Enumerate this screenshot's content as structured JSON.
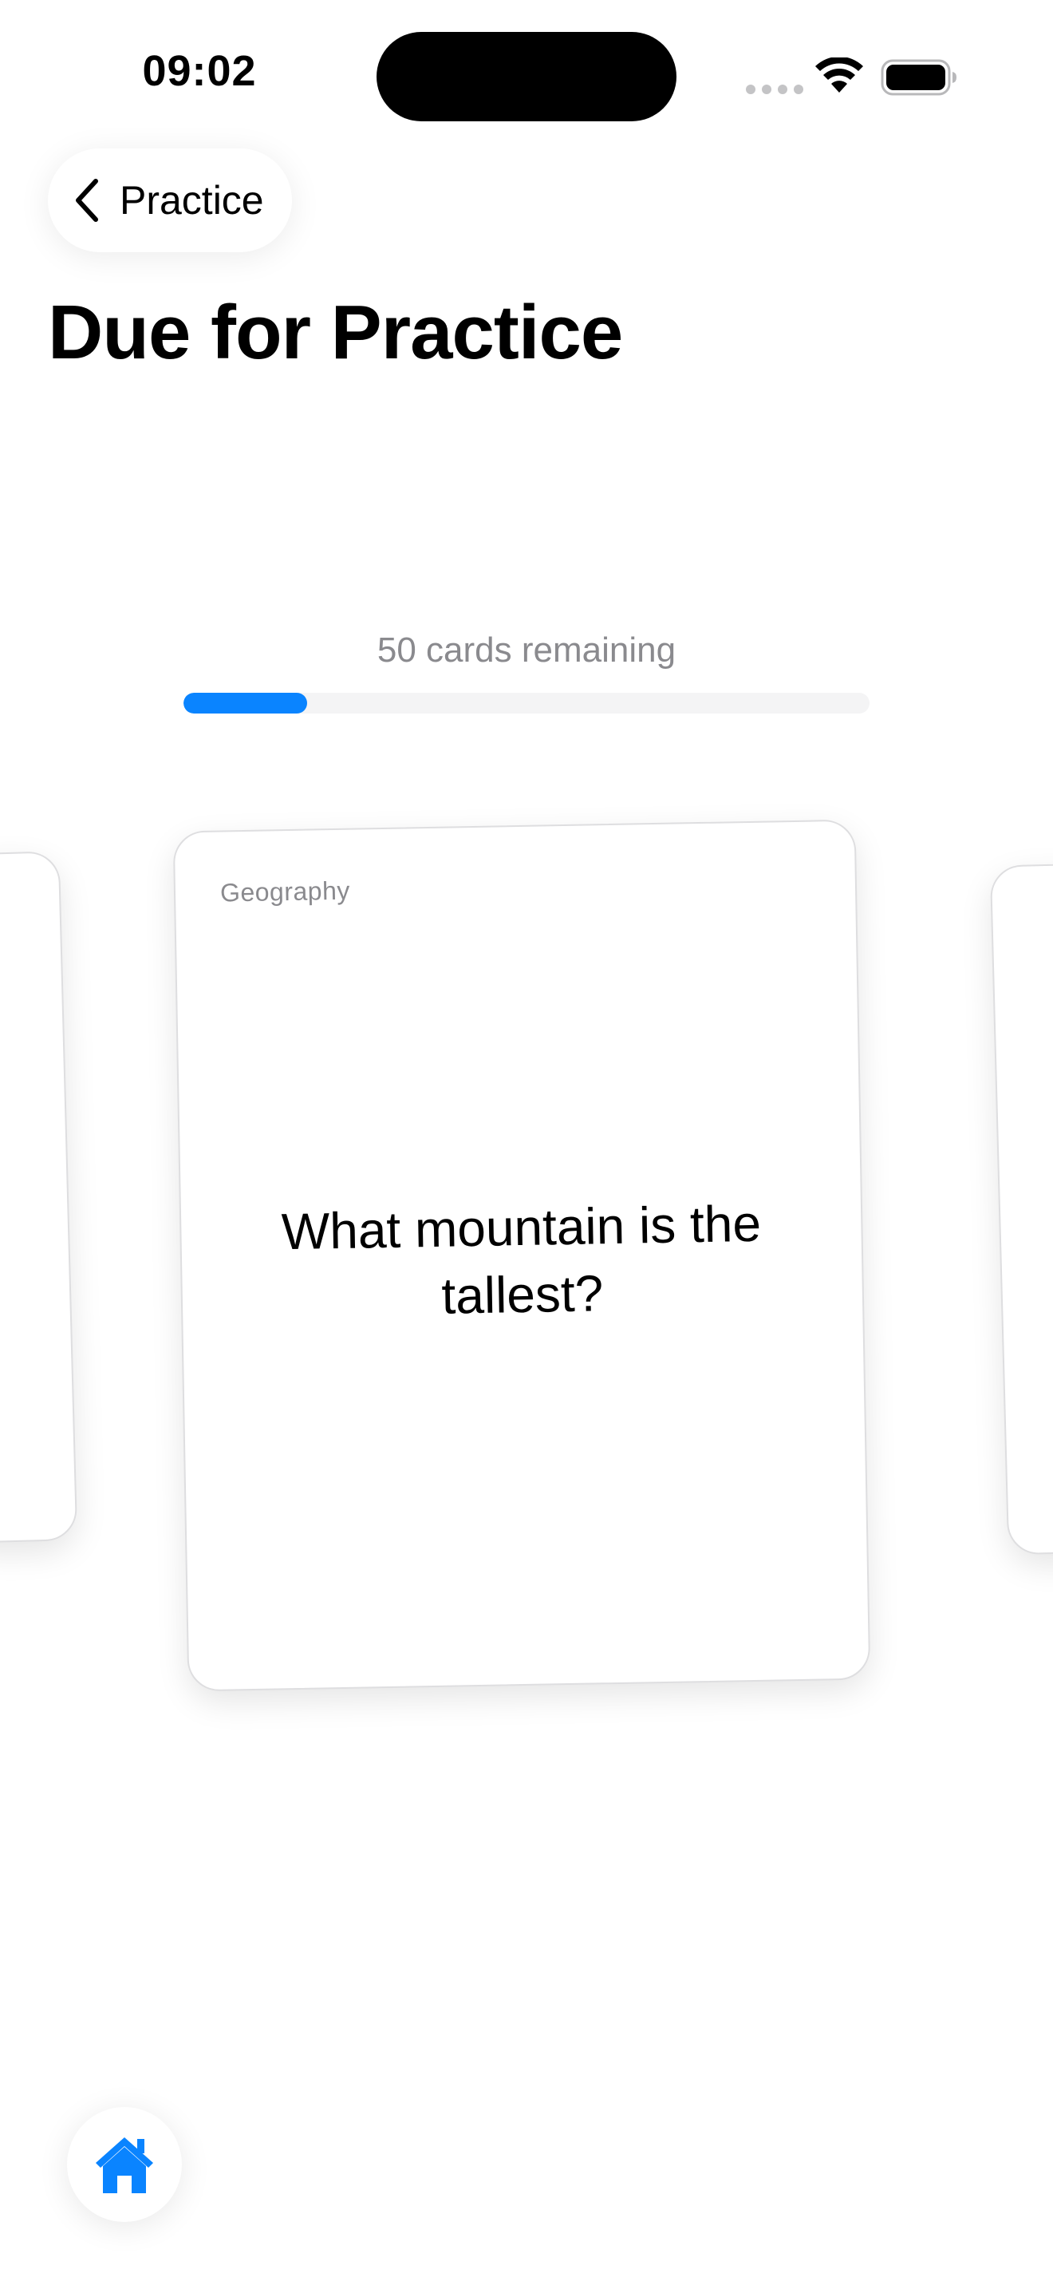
{
  "status_bar": {
    "time": "09:02"
  },
  "nav": {
    "back_label": "Practice",
    "title": "Due for Practice"
  },
  "progress": {
    "remaining_text": "50 cards remaining",
    "completed_fraction": 0.18,
    "accent_color": "#0a84ff"
  },
  "card": {
    "category": "Geography",
    "question": "What mountain is the tallest?"
  },
  "icons": {
    "back": "chevron-left-icon",
    "home": "house-icon",
    "wifi": "wifi-icon",
    "battery": "battery-icon"
  }
}
